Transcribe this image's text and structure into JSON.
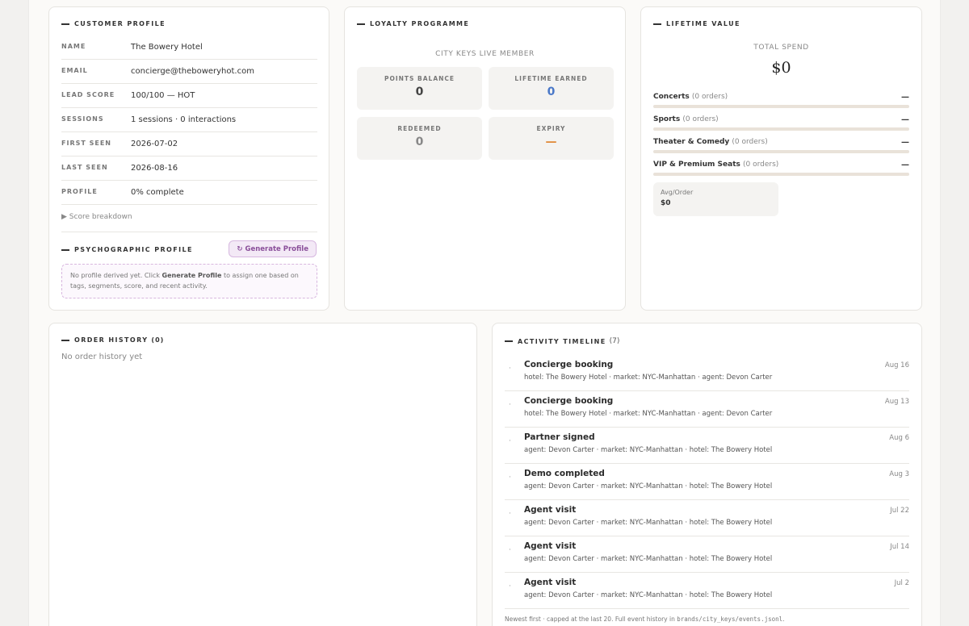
{
  "customer_profile": {
    "title": "Customer Profile",
    "fields": [
      {
        "label": "Name",
        "value": "The Bowery Hotel"
      },
      {
        "label": "Email",
        "value": "concierge@theboweryhot.com"
      },
      {
        "label": "Lead Score",
        "value": "100/100 — HOT"
      },
      {
        "label": "Sessions",
        "value": "1 sessions · 0 interactions"
      },
      {
        "label": "First Seen",
        "value": "2026-07-02"
      },
      {
        "label": "Last Seen",
        "value": "2026-08-16"
      },
      {
        "label": "Profile",
        "value": "0% complete"
      }
    ],
    "score_breakdown": "▶ Score breakdown"
  },
  "psychographic": {
    "title": "Psychographic Profile",
    "button": "↻ Generate Profile",
    "text_before": "No profile derived yet. Click ",
    "text_bold": "Generate Profile",
    "text_after": " to assign one based on tags, segments, score, and recent activity."
  },
  "loyalty": {
    "title": "Loyalty Programme",
    "member_label": "City Keys Live Member",
    "tiles": [
      {
        "label": "Points Balance",
        "value": "0",
        "color": "#444444"
      },
      {
        "label": "Lifetime Earned",
        "value": "0",
        "color": "#4a78c8"
      },
      {
        "label": "Redeemed",
        "value": "0",
        "color": "#888888"
      },
      {
        "label": "Expiry",
        "value": "—",
        "color": "#e08a3a"
      }
    ]
  },
  "lifetime": {
    "title": "Lifetime Value",
    "total_label": "Total Spend",
    "total_value": "$0",
    "categories": [
      {
        "name": "Concerts",
        "orders": "(0 orders)",
        "value": "—",
        "fill": 0
      },
      {
        "name": "Sports",
        "orders": "(0 orders)",
        "value": "—",
        "fill": 0
      },
      {
        "name": "Theater & Comedy",
        "orders": "(0 orders)",
        "value": "—",
        "fill": 0
      },
      {
        "name": "VIP & Premium Seats",
        "orders": "(0 orders)",
        "value": "—",
        "fill": 0
      }
    ],
    "avg_label": "Avg/Order",
    "avg_value": "$0"
  },
  "orders": {
    "title": "Order History",
    "count": "(0)",
    "empty": "No order history yet"
  },
  "activity": {
    "title": "Activity Timeline",
    "count": "(7)",
    "items": [
      {
        "title": "Concierge booking",
        "detail": "hotel: The Bowery Hotel · market: NYC-Manhattan · agent: Devon Carter",
        "date": "Aug 16"
      },
      {
        "title": "Concierge booking",
        "detail": "hotel: The Bowery Hotel · market: NYC-Manhattan · agent: Devon Carter",
        "date": "Aug 13"
      },
      {
        "title": "Partner signed",
        "detail": "agent: Devon Carter · market: NYC-Manhattan · hotel: The Bowery Hotel",
        "date": "Aug 6"
      },
      {
        "title": "Demo completed",
        "detail": "agent: Devon Carter · market: NYC-Manhattan · hotel: The Bowery Hotel",
        "date": "Aug 3"
      },
      {
        "title": "Agent visit",
        "detail": "agent: Devon Carter · market: NYC-Manhattan · hotel: The Bowery Hotel",
        "date": "Jul 22"
      },
      {
        "title": "Agent visit",
        "detail": "agent: Devon Carter · market: NYC-Manhattan · hotel: The Bowery Hotel",
        "date": "Jul 14"
      },
      {
        "title": "Agent visit",
        "detail": "agent: Devon Carter · market: NYC-Manhattan · hotel: The Bowery Hotel",
        "date": "Jul 2"
      }
    ],
    "footer_text": "Newest first · capped at the last 20. Full event history in ",
    "footer_code": "brands/city_keys/events.jsonl",
    "footer_end": "."
  }
}
